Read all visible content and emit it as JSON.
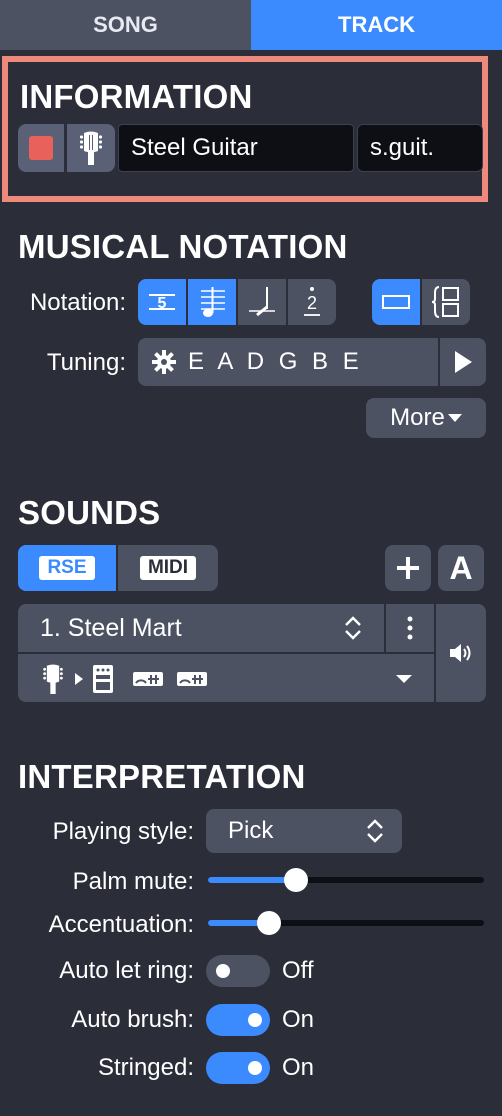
{
  "tabs": [
    {
      "label": "SONG",
      "active": false
    },
    {
      "label": "TRACK",
      "active": true
    }
  ],
  "information": {
    "title": "INFORMATION",
    "track_color": "#e8615a",
    "instrument_icon": "guitar-headstock-icon",
    "track_name": "Steel Guitar",
    "short_name": "s.guit."
  },
  "notation": {
    "title": "MUSICAL NOTATION",
    "notation_label": "Notation:",
    "tuning_label": "Tuning:",
    "tuning_value": "E A D G B E",
    "more_label": "More"
  },
  "sounds": {
    "title": "SOUNDS",
    "rse_label": "RSE",
    "midi_label": "MIDI",
    "add_label": "+",
    "auto_label": "A",
    "sound_name": "1. Steel Mart"
  },
  "interpretation": {
    "title": "INTERPRETATION",
    "playing_style_label": "Playing style:",
    "playing_style_value": "Pick",
    "palm_mute_label": "Palm mute:",
    "palm_mute_value": 0.32,
    "accentuation_label": "Accentuation:",
    "accentuation_value": 0.22,
    "auto_let_ring_label": "Auto let ring:",
    "auto_let_ring_state": "Off",
    "auto_brush_label": "Auto brush:",
    "auto_brush_state": "On",
    "stringed_label": "Stringed:",
    "stringed_state": "On"
  },
  "colors": {
    "accent": "#3b8bff",
    "panel": "#2b2d38",
    "button": "#4d5263",
    "highlight_border": "#ee8a7c"
  }
}
